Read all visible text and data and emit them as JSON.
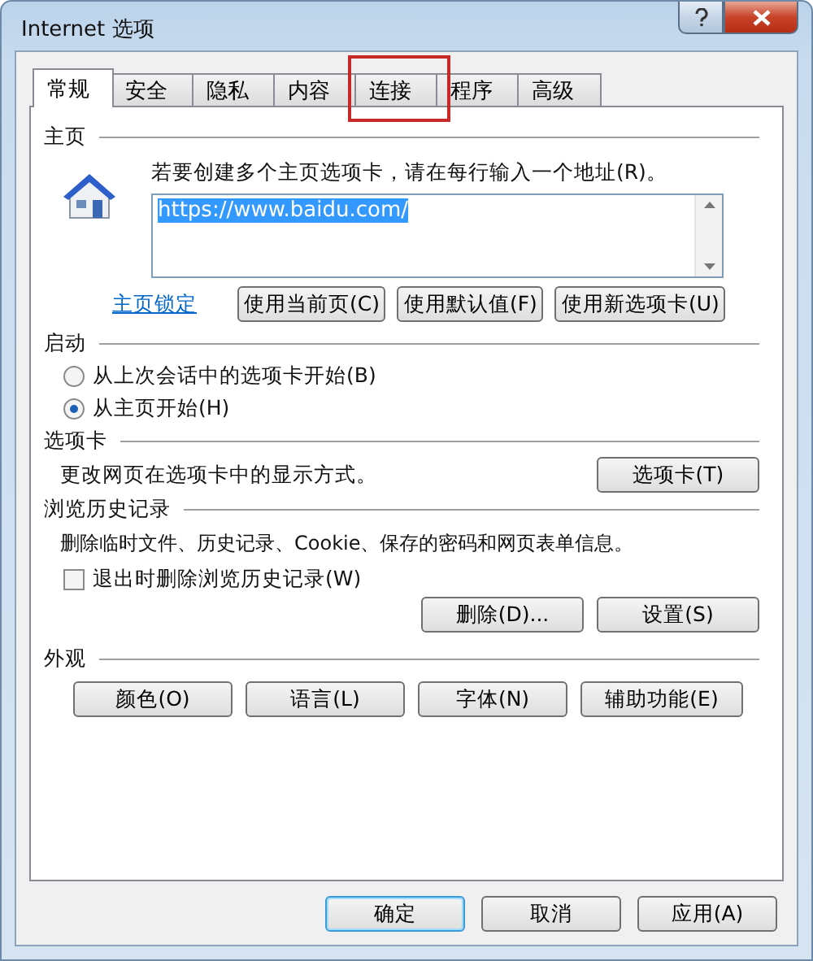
{
  "window": {
    "title": "Internet 选项"
  },
  "tabs": [
    {
      "label": "常规",
      "selected": true,
      "highlighted": false
    },
    {
      "label": "安全",
      "selected": false,
      "highlighted": false
    },
    {
      "label": "隐私",
      "selected": false,
      "highlighted": false
    },
    {
      "label": "内容",
      "selected": false,
      "highlighted": false
    },
    {
      "label": "连接",
      "selected": false,
      "highlighted": true
    },
    {
      "label": "程序",
      "selected": false,
      "highlighted": false
    },
    {
      "label": "高级",
      "selected": false,
      "highlighted": false
    }
  ],
  "homepage": {
    "heading": "主页",
    "hint": "若要创建多个主页选项卡，请在每行输入一个地址(R)。",
    "value": "https://www.baidu.com/",
    "lock_link": "主页锁定",
    "buttons": [
      "使用当前页(C)",
      "使用默认值(F)",
      "使用新选项卡(U)"
    ]
  },
  "startup": {
    "heading": "启动",
    "options": [
      {
        "label": "从上次会话中的选项卡开始(B)",
        "selected": false
      },
      {
        "label": "从主页开始(H)",
        "selected": true
      }
    ]
  },
  "tabs_section": {
    "heading": "选项卡",
    "text": "更改网页在选项卡中的显示方式。",
    "button": "选项卡(T)"
  },
  "history": {
    "heading": "浏览历史记录",
    "text": "删除临时文件、历史记录、Cookie、保存的密码和网页表单信息。",
    "checkbox": {
      "label": "退出时删除浏览历史记录(W)",
      "checked": false
    },
    "buttons": [
      "删除(D)...",
      "设置(S)"
    ]
  },
  "appearance": {
    "heading": "外观",
    "buttons": [
      "颜色(O)",
      "语言(L)",
      "字体(N)",
      "辅助功能(E)"
    ]
  },
  "footer_buttons": [
    {
      "label": "确定",
      "default": true
    },
    {
      "label": "取消",
      "default": false
    },
    {
      "label": "应用(A)",
      "default": false
    }
  ]
}
